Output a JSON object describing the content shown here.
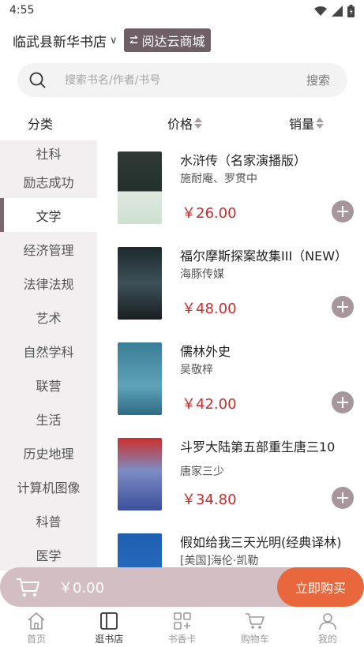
{
  "status_bar": {
    "time": "4:55"
  },
  "header": {
    "store_name": "临武县新华书店",
    "chevron": "∨",
    "switch_label": "阅达云商城"
  },
  "search": {
    "placeholder": "搜索书名/作者/书号",
    "button": "搜索"
  },
  "sort_bar": {
    "category": "分类",
    "price": "价格",
    "sales": "销量"
  },
  "categories": [
    {
      "label": "社科"
    },
    {
      "label": "励志成功"
    },
    {
      "label": "文学",
      "active": true
    },
    {
      "label": "经济管理"
    },
    {
      "label": "法律法规"
    },
    {
      "label": "艺术"
    },
    {
      "label": "自然学科"
    },
    {
      "label": "联营"
    },
    {
      "label": "生活"
    },
    {
      "label": "历史地理"
    },
    {
      "label": "计算机图像"
    },
    {
      "label": "科普"
    },
    {
      "label": "医学"
    }
  ],
  "books": [
    {
      "title": "水浒传（名家演播版）",
      "author": "施耐庵、罗贯中",
      "price": "￥26.00"
    },
    {
      "title": "福尔摩斯探案故集III（NEW）",
      "author": "海豚传媒",
      "price": "￥48.00"
    },
    {
      "title": "儒林外史",
      "author": "吴敬梓",
      "price": "￥42.00"
    },
    {
      "title": "斗罗大陆第五部重生唐三10",
      "author": "唐家三少",
      "price": "￥34.80"
    },
    {
      "title": "假如给我三天光明(经典译林)",
      "author": "[美国]海伦·凯勒",
      "price": ""
    }
  ],
  "cart": {
    "total": "￥0.00",
    "buy_label": "立即购买"
  },
  "tabs": [
    {
      "label": "首页",
      "icon": "home-icon"
    },
    {
      "label": "逛书店",
      "icon": "bookstore-icon",
      "active": true
    },
    {
      "label": "书香卡",
      "icon": "card-icon"
    },
    {
      "label": "购物车",
      "icon": "cart-icon"
    },
    {
      "label": "我的",
      "icon": "profile-icon"
    }
  ],
  "colors": {
    "accent": "#7a6a70",
    "price": "#cc2a2a",
    "buy": "#e8673c",
    "cart_bar": "#d3bfc3"
  }
}
